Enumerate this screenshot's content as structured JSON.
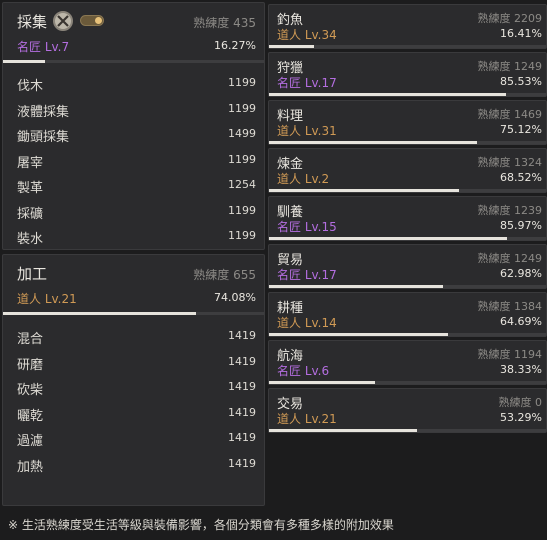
{
  "gathering": {
    "title": "採集",
    "proficiency": "熟練度 435",
    "level": "名匠 Lv.7",
    "level_tier": "purple",
    "percent": "16.27%",
    "progress": 0.1627,
    "items": [
      {
        "name": "伐木",
        "value": "1199"
      },
      {
        "name": "液體採集",
        "value": "1199"
      },
      {
        "name": "鋤頭採集",
        "value": "1499"
      },
      {
        "name": "屠宰",
        "value": "1199"
      },
      {
        "name": "製革",
        "value": "1254"
      },
      {
        "name": "採礦",
        "value": "1199"
      },
      {
        "name": "裝水",
        "value": "1199"
      }
    ]
  },
  "processing": {
    "title": "加工",
    "proficiency": "熟練度 655",
    "level": "道人 Lv.21",
    "level_tier": "orange",
    "percent": "74.08%",
    "progress": 0.7408,
    "items": [
      {
        "name": "混合",
        "value": "1419"
      },
      {
        "name": "研磨",
        "value": "1419"
      },
      {
        "name": "砍柴",
        "value": "1419"
      },
      {
        "name": "曬乾",
        "value": "1419"
      },
      {
        "name": "過濾",
        "value": "1419"
      },
      {
        "name": "加熱",
        "value": "1419"
      }
    ]
  },
  "skills": [
    {
      "title": "釣魚",
      "proficiency": "熟練度 2209",
      "level": "道人 Lv.34",
      "tier": "orange",
      "percent": "16.41%",
      "progress": 0.1641
    },
    {
      "title": "狩獵",
      "proficiency": "熟練度 1249",
      "level": "名匠 Lv.17",
      "tier": "purple",
      "percent": "85.53%",
      "progress": 0.8553
    },
    {
      "title": "料理",
      "proficiency": "熟練度 1469",
      "level": "道人 Lv.31",
      "tier": "orange",
      "percent": "75.12%",
      "progress": 0.7512
    },
    {
      "title": "煉金",
      "proficiency": "熟練度 1324",
      "level": "道人 Lv.2",
      "tier": "orange",
      "percent": "68.52%",
      "progress": 0.6852
    },
    {
      "title": "馴養",
      "proficiency": "熟練度 1239",
      "level": "名匠 Lv.15",
      "tier": "purple",
      "percent": "85.97%",
      "progress": 0.8597
    },
    {
      "title": "貿易",
      "proficiency": "熟練度 1249",
      "level": "名匠 Lv.17",
      "tier": "purple",
      "percent": "62.98%",
      "progress": 0.6298
    },
    {
      "title": "耕種",
      "proficiency": "熟練度 1384",
      "level": "道人 Lv.14",
      "tier": "orange",
      "percent": "64.69%",
      "progress": 0.6469
    },
    {
      "title": "航海",
      "proficiency": "熟練度 1194",
      "level": "名匠 Lv.6",
      "tier": "purple",
      "percent": "38.33%",
      "progress": 0.3833
    },
    {
      "title": "交易",
      "proficiency": "熟練度 0",
      "level": "道人 Lv.21",
      "tier": "orange",
      "percent": "53.29%",
      "progress": 0.5329
    }
  ],
  "footnote": "※ 生活熟練度受生活等級與裝備影響，各個分類會有多種多樣的附加效果",
  "colors": {
    "orange": "#d09a55",
    "purple": "#b46ee0",
    "bar": "#e6e3dc"
  },
  "icons": {
    "tools": "crossed-tools-icon",
    "toggle": "toggle-switch"
  }
}
